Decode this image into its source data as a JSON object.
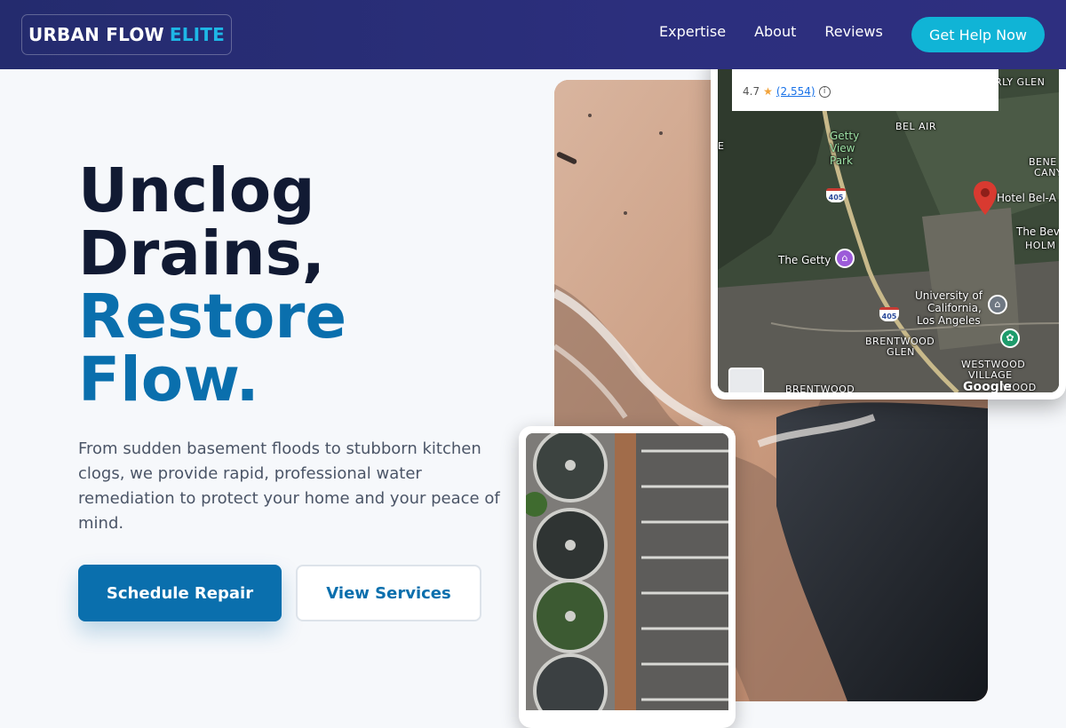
{
  "brand": {
    "name": "URBAN FLOW",
    "accent": "ELITE"
  },
  "nav": {
    "links": [
      "Expertise",
      "About",
      "Reviews"
    ],
    "cta": "Get Help Now"
  },
  "hero": {
    "line1": "Unclog",
    "line2": "Drains,",
    "line3": "Restore",
    "line4": "Flow.",
    "lead": "From sudden basement floods to stubborn kitchen clogs, we provide rapid, professional water remediation to protect your home and your peace of mind.",
    "primary_button": "Schedule Repair",
    "secondary_button": "View Services"
  },
  "map": {
    "rating": "4.7",
    "reviews": "(2,554)",
    "labels": {
      "getty_view": "Getty View Park",
      "bel_air": "BEL AIR",
      "the_getty": "The Getty",
      "hotel": "Hotel Bel-A",
      "bev": "The Bev",
      "holm": "HOLM",
      "bene": "BENE",
      "cany": "CANY",
      "rly_glen": "RLY GLEN",
      "ucla1": "University of",
      "ucla2": "California,",
      "ucla3": "Los Angeles",
      "brentwood_glen1": "BRENTWOOD",
      "brentwood_glen2": "GLEN",
      "westwood1": "WESTWOOD",
      "westwood2": "VILLAGE",
      "brentwood": "BRENTWOOD",
      "hwy": "405",
      "wood": "WOOD",
      "e": "E"
    },
    "attribution": "Google"
  },
  "colors": {
    "nav": "#2c2f7d",
    "accent": "#10b4d6",
    "primary": "#0a6fad",
    "headline": "#111a33"
  }
}
